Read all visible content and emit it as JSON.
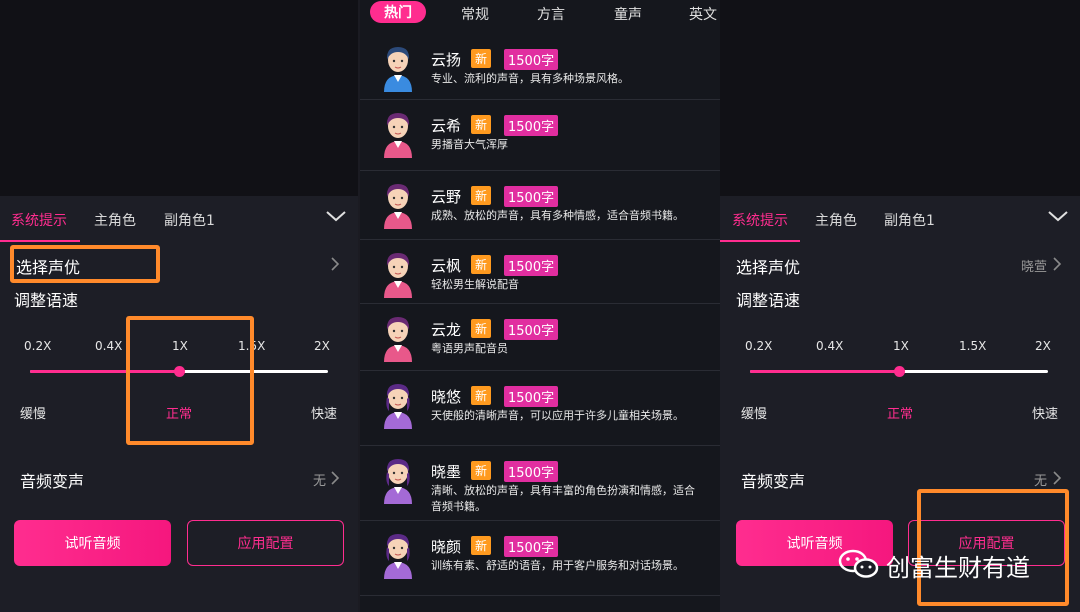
{
  "panels": {
    "tabs": [
      "系统提示",
      "主角色",
      "副角色1"
    ],
    "voice_row_label": "选择声优",
    "speed_row_label": "调整语速",
    "speed_marks": [
      "0.2X",
      "0.4X",
      "1X",
      "1.5X",
      "2X"
    ],
    "speed_left_marks": [
      "0.2X",
      "0.4X",
      "1X",
      "1.5X",
      "2X"
    ],
    "speed_fraction": 0.5,
    "speed_words": [
      "缓慢",
      "正常",
      "快速"
    ],
    "effect_row_label": "音频变声",
    "effect_value": "无",
    "preview_button": "试听音频",
    "apply_button": "应用配置",
    "selected_voice_right": "晓萱"
  },
  "voice_picker": {
    "tabs": [
      "热门",
      "常规",
      "方言",
      "童声",
      "英文"
    ],
    "items": [
      {
        "name": "云扬",
        "new": "新",
        "count": "1500字",
        "desc": "专业、流利的声音，具有多种场景风格。",
        "gender": "male"
      },
      {
        "name": "云希",
        "new": "新",
        "count": "1500字",
        "desc": "男播音大气浑厚",
        "gender": "male2"
      },
      {
        "name": "云野",
        "new": "新",
        "count": "1500字",
        "desc": "成熟、放松的声音，具有多种情感，适合音频书籍。",
        "gender": "male2"
      },
      {
        "name": "云枫",
        "new": "新",
        "count": "1500字",
        "desc": "轻松男生解说配音",
        "gender": "male2"
      },
      {
        "name": "云龙",
        "new": "新",
        "count": "1500字",
        "desc": "粤语男声配音员",
        "gender": "male2"
      },
      {
        "name": "晓悠",
        "new": "新",
        "count": "1500字",
        "desc": "天使般的清晰声音，可以应用于许多儿童相关场景。",
        "gender": "female"
      },
      {
        "name": "晓墨",
        "new": "新",
        "count": "1500字",
        "desc": "清晰、放松的声音，具有丰富的角色扮演和情感，适合音频书籍。",
        "gender": "female"
      },
      {
        "name": "晓颜",
        "new": "新",
        "count": "1500字",
        "desc": "训练有素、舒适的语音，用于客户服务和对话场景。",
        "gender": "female"
      }
    ]
  },
  "watermark": "创富生财有道",
  "colors": {
    "accent": "#ff2d8f",
    "highlight": "#ff8a2b",
    "badge_new": "#ff9a1f",
    "badge_count": "#e12ea0"
  }
}
